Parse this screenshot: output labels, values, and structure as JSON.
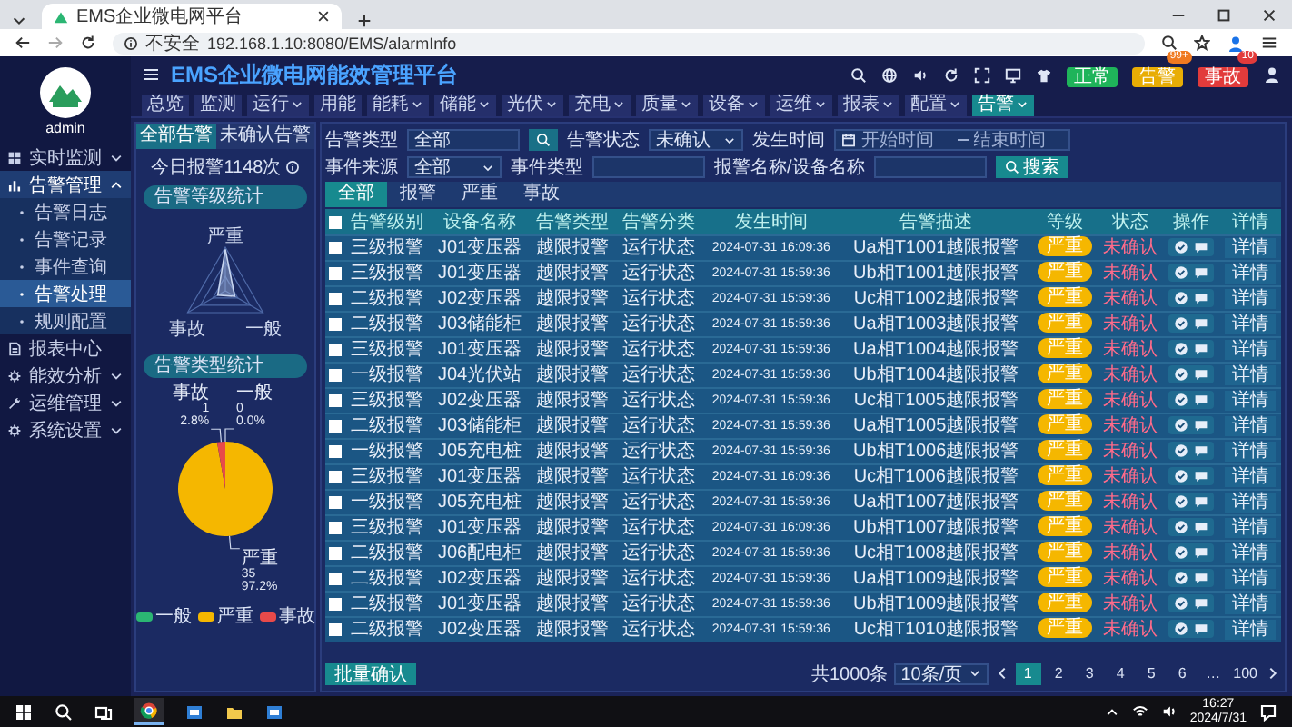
{
  "browser": {
    "tab_title": "EMS企业微电网平台",
    "security": "不安全",
    "url": "192.168.1.10:8080/EMS/alarmInfo"
  },
  "sidebar": {
    "user": "admin",
    "menu": [
      {
        "label": "实时监测",
        "expanded": false,
        "selected": false
      },
      {
        "label": "告警管理",
        "expanded": true,
        "selected": true,
        "children": [
          {
            "label": "告警日志",
            "selected": false
          },
          {
            "label": "告警记录",
            "selected": false
          },
          {
            "label": "事件查询",
            "selected": false
          },
          {
            "label": "告警处理",
            "selected": true
          },
          {
            "label": "规则配置",
            "selected": false
          }
        ]
      },
      {
        "label": "报表中心",
        "selected": false
      },
      {
        "label": "能效分析",
        "expanded": false,
        "selected": false
      },
      {
        "label": "运维管理",
        "expanded": false,
        "selected": false
      },
      {
        "label": "系统设置",
        "expanded": false,
        "selected": false
      }
    ]
  },
  "header": {
    "title": "EMS企业微电网能效管理平台",
    "badges": [
      {
        "label": "正常",
        "kind": "ok"
      },
      {
        "label": "告警",
        "kind": "warn",
        "count": "99+"
      },
      {
        "label": "事故",
        "kind": "fault",
        "count": "10"
      }
    ],
    "nav": [
      {
        "label": "总览",
        "has_menu": false,
        "selected": false
      },
      {
        "label": "监测",
        "has_menu": false,
        "selected": false
      },
      {
        "label": "运行",
        "has_menu": true,
        "selected": false
      },
      {
        "label": "用能",
        "has_menu": false,
        "selected": false
      },
      {
        "label": "能耗",
        "has_menu": true,
        "selected": false
      },
      {
        "label": "储能",
        "has_menu": true,
        "selected": false
      },
      {
        "label": "光伏",
        "has_menu": true,
        "selected": false
      },
      {
        "label": "充电",
        "has_menu": true,
        "selected": false
      },
      {
        "label": "质量",
        "has_menu": true,
        "selected": false
      },
      {
        "label": "设备",
        "has_menu": true,
        "selected": false
      },
      {
        "label": "运维",
        "has_menu": true,
        "selected": false
      },
      {
        "label": "报表",
        "has_menu": true,
        "selected": false
      },
      {
        "label": "配置",
        "has_menu": true,
        "selected": false
      },
      {
        "label": "告警",
        "has_menu": true,
        "selected": true
      }
    ]
  },
  "left_panel": {
    "tabs": [
      {
        "label": "全部告警",
        "selected": true
      },
      {
        "label": "未确认告警",
        "selected": false
      }
    ],
    "today": "今日报警1148次",
    "level_chart": {
      "title": "告警等级统计",
      "axes": [
        "严重",
        "一般",
        "事故"
      ]
    },
    "type_chart": {
      "title": "告警类型统计",
      "chart_data": {
        "type": "pie",
        "categories": [
          "一般",
          "严重",
          "事故"
        ],
        "colors": [
          "#2bb673",
          "#f5b700",
          "#e84a4a"
        ],
        "values": [
          0,
          97.2,
          2.8
        ],
        "value_labels": [
          "0.0%",
          "97.2%",
          "2.8%"
        ]
      },
      "slice_counts": [
        "0",
        "35",
        "1"
      ]
    }
  },
  "filters": {
    "rows": [
      [
        {
          "label": "告警类型",
          "kind": "search",
          "value": "全部"
        },
        {
          "label": "告警状态",
          "kind": "select",
          "value": "未确认"
        },
        {
          "label": "发生时间",
          "kind": "daterange",
          "placeholder": "开始时间",
          "placeholder_end": "结束时间"
        }
      ],
      [
        {
          "label": "事件来源",
          "kind": "select",
          "value": "全部"
        },
        {
          "label": "事件类型",
          "kind": "input"
        },
        {
          "label": "报警名称/设备名称",
          "kind": "input"
        }
      ]
    ],
    "search_button": "搜索"
  },
  "alarm_tabs": [
    {
      "label": "全部",
      "selected": true
    },
    {
      "label": "报警",
      "selected": false
    },
    {
      "label": "严重",
      "selected": false
    },
    {
      "label": "事故",
      "selected": false
    }
  ],
  "table": {
    "header_checked": false,
    "columns": [
      "告警级别",
      "设备名称",
      "告警类型",
      "告警分类",
      "发生时间",
      "告警描述",
      "等级",
      "状态",
      "操作",
      "详情"
    ],
    "rows": [
      {
        "checked": false,
        "cells": [
          "三级报警",
          "J01变压器",
          "越限报警",
          "运行状态",
          "2024-07-31 16:09:36",
          "Ua相T1001越限报警",
          "严重",
          "未确认"
        ],
        "action": "详情"
      },
      {
        "checked": false,
        "cells": [
          "三级报警",
          "J01变压器",
          "越限报警",
          "运行状态",
          "2024-07-31 15:59:36",
          "Ub相T1001越限报警",
          "严重",
          "未确认"
        ],
        "action": "详情"
      },
      {
        "checked": false,
        "cells": [
          "二级报警",
          "J02变压器",
          "越限报警",
          "运行状态",
          "2024-07-31 15:59:36",
          "Uc相T1002越限报警",
          "严重",
          "未确认"
        ],
        "action": "详情"
      },
      {
        "checked": false,
        "cells": [
          "二级报警",
          "J03储能柜",
          "越限报警",
          "运行状态",
          "2024-07-31 15:59:36",
          "Ua相T1003越限报警",
          "严重",
          "未确认"
        ],
        "action": "详情"
      },
      {
        "checked": false,
        "cells": [
          "三级报警",
          "J01变压器",
          "越限报警",
          "运行状态",
          "2024-07-31 15:59:36",
          "Ua相T1004越限报警",
          "严重",
          "未确认"
        ],
        "action": "详情"
      },
      {
        "checked": false,
        "cells": [
          "一级报警",
          "J04光伏站",
          "越限报警",
          "运行状态",
          "2024-07-31 15:59:36",
          "Ub相T1004越限报警",
          "严重",
          "未确认"
        ],
        "action": "详情"
      },
      {
        "checked": false,
        "cells": [
          "三级报警",
          "J02变压器",
          "越限报警",
          "运行状态",
          "2024-07-31 15:59:36",
          "Uc相T1005越限报警",
          "严重",
          "未确认"
        ],
        "action": "详情"
      },
      {
        "checked": false,
        "cells": [
          "二级报警",
          "J03储能柜",
          "越限报警",
          "运行状态",
          "2024-07-31 15:59:36",
          "Ua相T1005越限报警",
          "严重",
          "未确认"
        ],
        "action": "详情"
      },
      {
        "checked": false,
        "cells": [
          "一级报警",
          "J05充电桩",
          "越限报警",
          "运行状态",
          "2024-07-31 15:59:36",
          "Ub相T1006越限报警",
          "严重",
          "未确认"
        ],
        "action": "详情"
      },
      {
        "checked": false,
        "cells": [
          "三级报警",
          "J01变压器",
          "越限报警",
          "运行状态",
          "2024-07-31 16:09:36",
          "Uc相T1006越限报警",
          "严重",
          "未确认"
        ],
        "action": "详情"
      },
      {
        "checked": false,
        "cells": [
          "一级报警",
          "J05充电桩",
          "越限报警",
          "运行状态",
          "2024-07-31 15:59:36",
          "Ua相T1007越限报警",
          "严重",
          "未确认"
        ],
        "action": "详情"
      },
      {
        "checked": false,
        "cells": [
          "三级报警",
          "J01变压器",
          "越限报警",
          "运行状态",
          "2024-07-31 16:09:36",
          "Ub相T1007越限报警",
          "严重",
          "未确认"
        ],
        "action": "详情"
      },
      {
        "checked": false,
        "cells": [
          "二级报警",
          "J06配电柜",
          "越限报警",
          "运行状态",
          "2024-07-31 15:59:36",
          "Uc相T1008越限报警",
          "严重",
          "未确认"
        ],
        "action": "详情"
      },
      {
        "checked": false,
        "cells": [
          "二级报警",
          "J02变压器",
          "越限报警",
          "运行状态",
          "2024-07-31 15:59:36",
          "Ua相T1009越限报警",
          "严重",
          "未确认"
        ],
        "action": "详情"
      },
      {
        "checked": false,
        "cells": [
          "二级报警",
          "J01变压器",
          "越限报警",
          "运行状态",
          "2024-07-31 15:59:36",
          "Ub相T1009越限报警",
          "严重",
          "未确认"
        ],
        "action": "详情"
      },
      {
        "checked": false,
        "cells": [
          "二级报警",
          "J02变压器",
          "越限报警",
          "运行状态",
          "2024-07-31 15:59:36",
          "Uc相T1010越限报警",
          "严重",
          "未确认"
        ],
        "action": "详情"
      }
    ]
  },
  "footer": {
    "batch_button": "批量确认",
    "total": "共1000条",
    "page_size": "10条/页",
    "pages": [
      {
        "label": "1",
        "selected": true
      },
      {
        "label": "2",
        "selected": false
      },
      {
        "label": "3",
        "selected": false
      },
      {
        "label": "4",
        "selected": false
      },
      {
        "label": "5",
        "selected": false
      },
      {
        "label": "6",
        "selected": false
      },
      {
        "label": "…",
        "selected": false
      },
      {
        "label": "100",
        "selected": false
      }
    ]
  },
  "taskbar": {
    "time": "16:27",
    "date": "2024/7/31"
  }
}
